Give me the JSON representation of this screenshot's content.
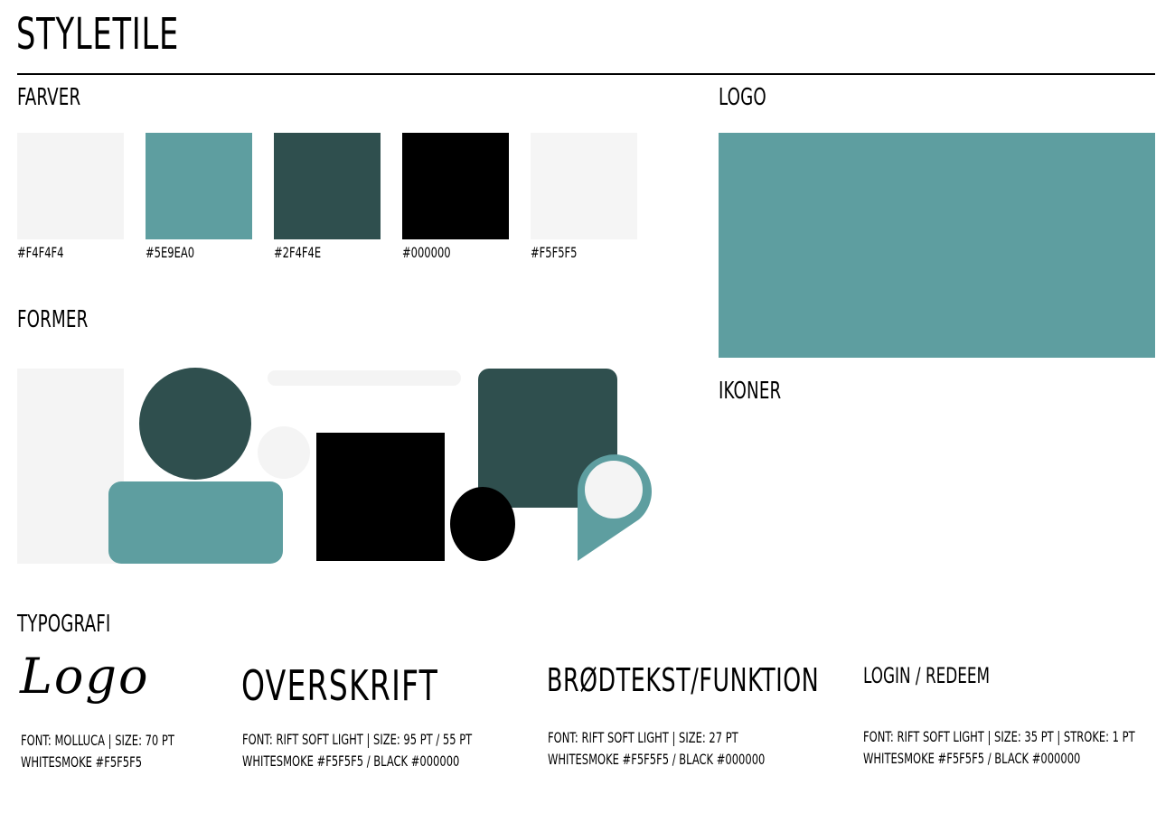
{
  "title": "STYLETILE",
  "headings": {
    "colors": "FARVER",
    "shapes": "FORMER",
    "logo": "LOGO",
    "icons": "IKONER",
    "typography": "TYPOGRAFI"
  },
  "swatches": [
    {
      "hex": "#F4F4F4",
      "label": "#F4F4F4"
    },
    {
      "hex": "#5E9EA0",
      "label": "#5E9EA0"
    },
    {
      "hex": "#2F4F4E",
      "label": "#2F4F4E"
    },
    {
      "hex": "#000000",
      "label": "#000000"
    },
    {
      "hex": "#F5F5F5",
      "label": "#F5F5F5"
    }
  ],
  "logo_color": "#5E9EA0",
  "colors": {
    "light": "#F4F4F4",
    "teal": "#5E9EA0",
    "dark": "#2F4F4E",
    "black": "#000000"
  },
  "typography": [
    {
      "sample": "Logo",
      "line1": "FONT: MOLLUCA | SIZE: 70 PT",
      "line2": "WHITESMOKE #F5F5F5"
    },
    {
      "sample": "OVERSKRIFT",
      "line1": "FONT: RIFT SOFT LIGHT | SIZE: 95 PT / 55 PT",
      "line2": "WHITESMOKE #F5F5F5 / BLACK #000000"
    },
    {
      "sample": "BRØDTEKST/FUNKTION",
      "line1": "FONT: RIFT SOFT LIGHT | SIZE: 27 PT",
      "line2": "WHITESMOKE #F5F5F5 / BLACK #000000"
    },
    {
      "sample": "LOGIN / REDEEM",
      "line1": "FONT: RIFT SOFT LIGHT | SIZE: 35 PT | STROKE: 1 PT",
      "line2": "WHITESMOKE #F5F5F5 / BLACK #000000"
    }
  ]
}
